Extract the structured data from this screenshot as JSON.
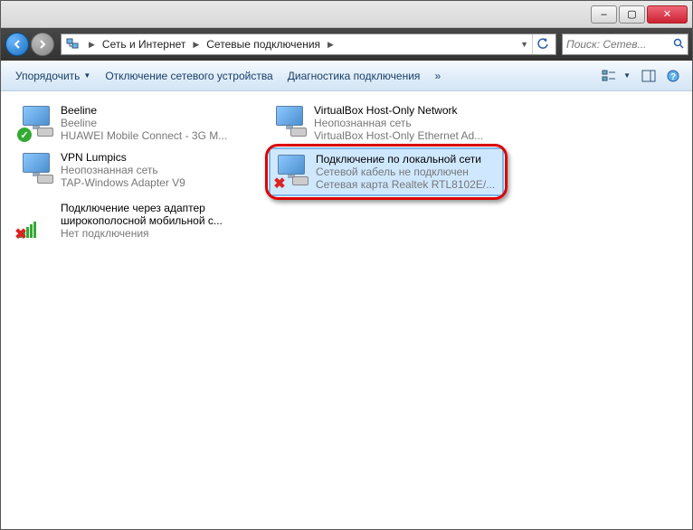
{
  "window": {
    "minimize": "–",
    "maximize": "▢",
    "close": "✕"
  },
  "breadcrumb": {
    "level1": "Сеть и Интернет",
    "level2": "Сетевые подключения"
  },
  "search": {
    "placeholder": "Поиск: Сетев..."
  },
  "toolbar": {
    "organize": "Упорядочить",
    "disable": "Отключение сетевого устройства",
    "diagnose": "Диагностика подключения",
    "more": "»"
  },
  "connections": [
    {
      "name": "Beeline",
      "line2": "Beeline",
      "line3": "HUAWEI Mobile Connect - 3G M...",
      "badge": "ok"
    },
    {
      "name": "VirtualBox Host-Only Network",
      "line2": "Неопознанная сеть",
      "line3": "VirtualBox Host-Only Ethernet Ad...",
      "badge": "none"
    },
    {
      "name": "VPN Lumpics",
      "line2": "Неопознанная сеть",
      "line3": "TAP-Windows Adapter V9",
      "badge": "none"
    },
    {
      "name": "Подключение по локальной сети",
      "line2": "Сетевой кабель не подключен",
      "line3": "Сетевая карта Realtek RTL8102E/...",
      "badge": "x",
      "selected": true,
      "highlighted": true
    },
    {
      "name": "Подключение через адаптер широкополосной мобильной с...",
      "line2": "Нет подключения",
      "line3": "",
      "badge": "signal-x"
    }
  ]
}
